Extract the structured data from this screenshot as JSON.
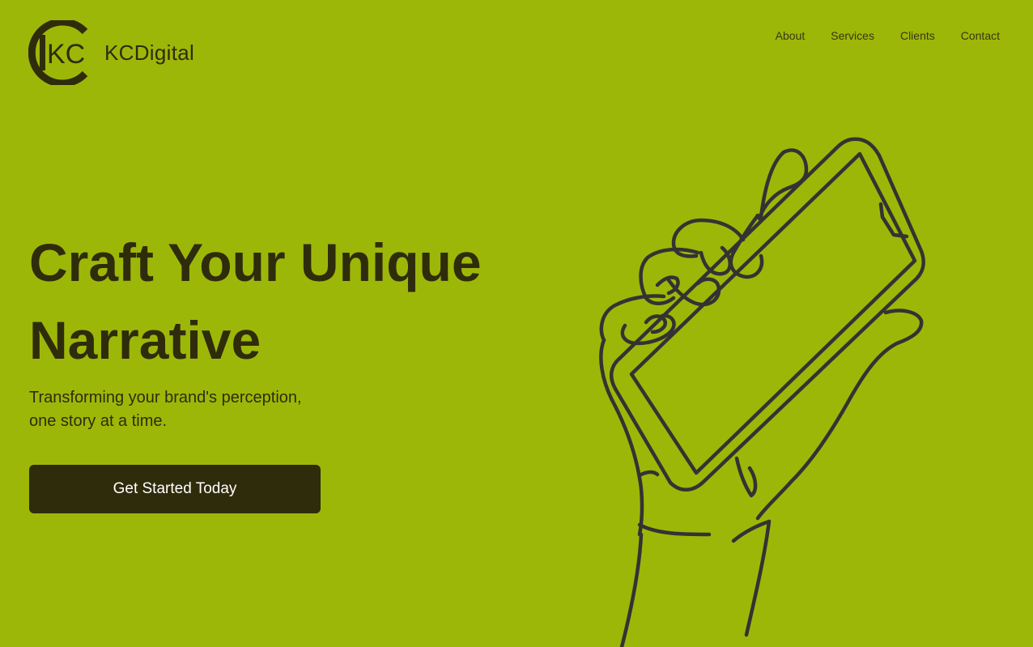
{
  "brand": {
    "monogram": "KC",
    "name": "KCDigital"
  },
  "nav": {
    "items": [
      {
        "label": "About"
      },
      {
        "label": "Services"
      },
      {
        "label": "Clients"
      },
      {
        "label": "Contact"
      }
    ]
  },
  "hero": {
    "title_line1": "Craft Your Unique",
    "title_line2": "Narrative",
    "subtitle_line1": "Transforming your brand's perception,",
    "subtitle_line2": "one story at a time.",
    "cta_label": "Get Started Today",
    "illustration_icon": "hand-holding-phone-line-art"
  },
  "colors": {
    "background": "#9db708",
    "ink": "#2f2c0c",
    "button_bg": "#2f2c0c",
    "button_text": "#ffffff",
    "line_art": "#333333"
  }
}
